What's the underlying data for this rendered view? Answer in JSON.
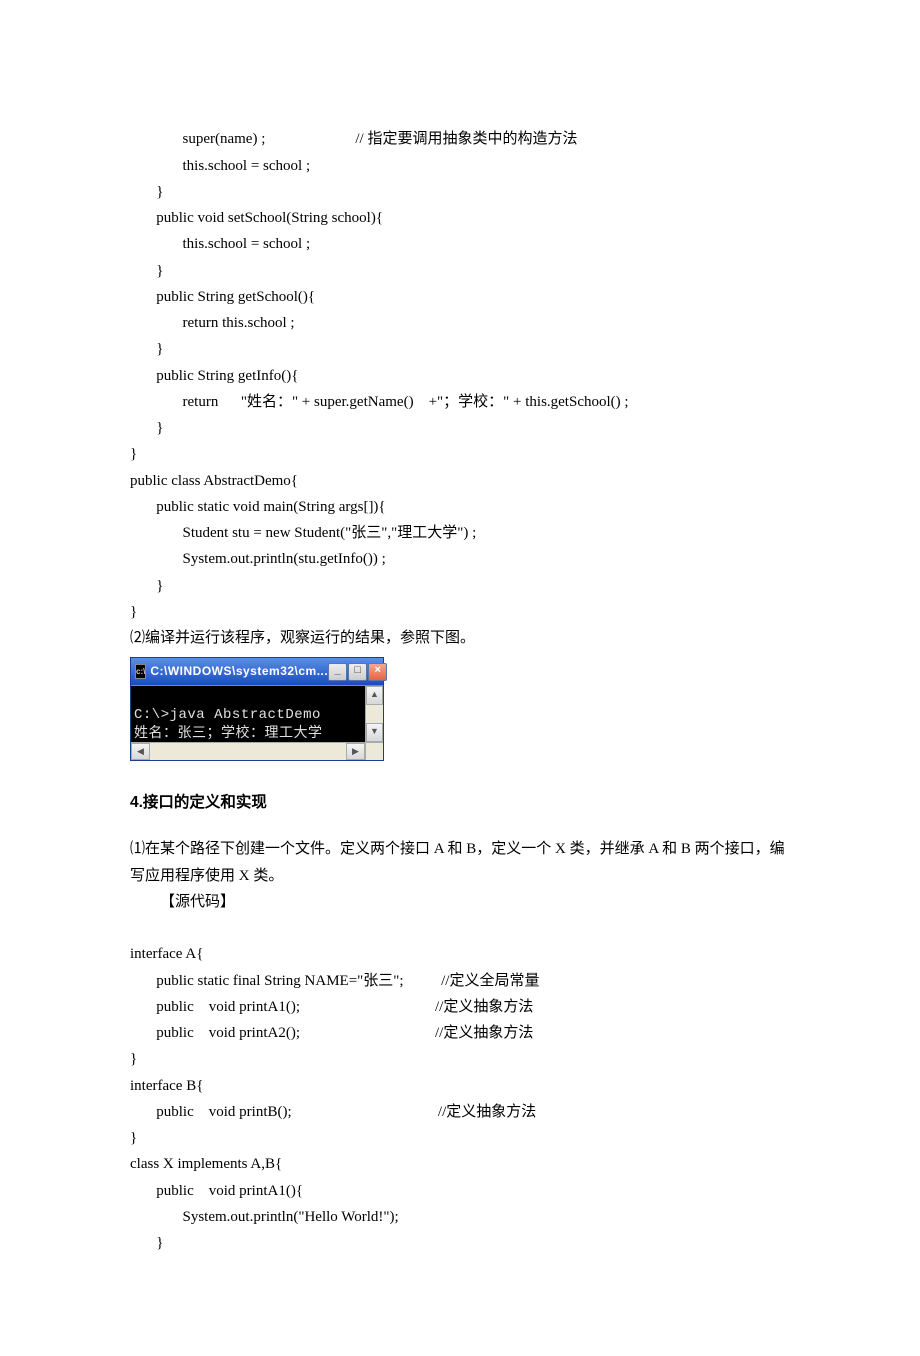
{
  "code1": {
    "l1a": "              super(name)",
    "l1b": " ;                        // 指定要调用抽象类中的构造方法",
    "l2": "              this.school = school ;",
    "l3": "       }",
    "l4": "       public void setSchool(String school){",
    "l5": "              this.school = school ;",
    "l6": "       }",
    "l7": "       public String getSchool(){",
    "l8": "              return this.school ;",
    "l9": "       }",
    "l10": "       public String getInfo(){",
    "l11": "              return      \"姓名：\" + super.getName()    +\"；学校：\" + this.getSchool() ;",
    "l12": "       }",
    "l13": "}",
    "l14": "public class AbstractDemo{",
    "l15": "       public static void main(String args[]){",
    "l16": "              Student stu = new Student(\"张三\",\"理工大学\") ;",
    "l17": "              System.out.println(stu.getInfo()) ;",
    "l18": "       }",
    "l19": "}"
  },
  "note2": "⑵编译并运行该程序，观察运行的结果，参照下图。",
  "cmd": {
    "title": "C:\\WINDOWS\\system32\\cm...",
    "icon_text": "c:\\",
    "line1": "C:\\>java AbstractDemo",
    "line2": "姓名：张三；学校：理工大学",
    "btn_min": "_",
    "btn_max": "□",
    "btn_close": "×",
    "arrow_up": "▲",
    "arrow_down": "▼",
    "arrow_left": "◀",
    "arrow_right": "▶"
  },
  "heading4": "4.接口的定义和实现",
  "para1": "       ⑴在某个路径下创建一个文件。定义两个接口 A 和 B，定义一个 X 类，并继承 A 和 B 两个接口，编写应用程序使用 X 类。",
  "src_label": "【源代码】",
  "code2": {
    "l1": "interface A{",
    "l2a": "       public static final String NAME=\"张三\";",
    "l2b": "          //定义全局常量",
    "l3a": "       public    void printA1();",
    "l3b": "                                    //定义抽象方法",
    "l4a": "       public    void printA2();",
    "l4b": "                                    //定义抽象方法",
    "l5": "}",
    "l6": "interface B{",
    "l7a": "       public    void printB();",
    "l7b": "                                       //定义抽象方法",
    "l8": "}",
    "l9": "class X implements A,B{",
    "l10": "       public    void printA1(){",
    "l11": "              System.out.println(\"Hello World!\");",
    "l12": "       }"
  }
}
